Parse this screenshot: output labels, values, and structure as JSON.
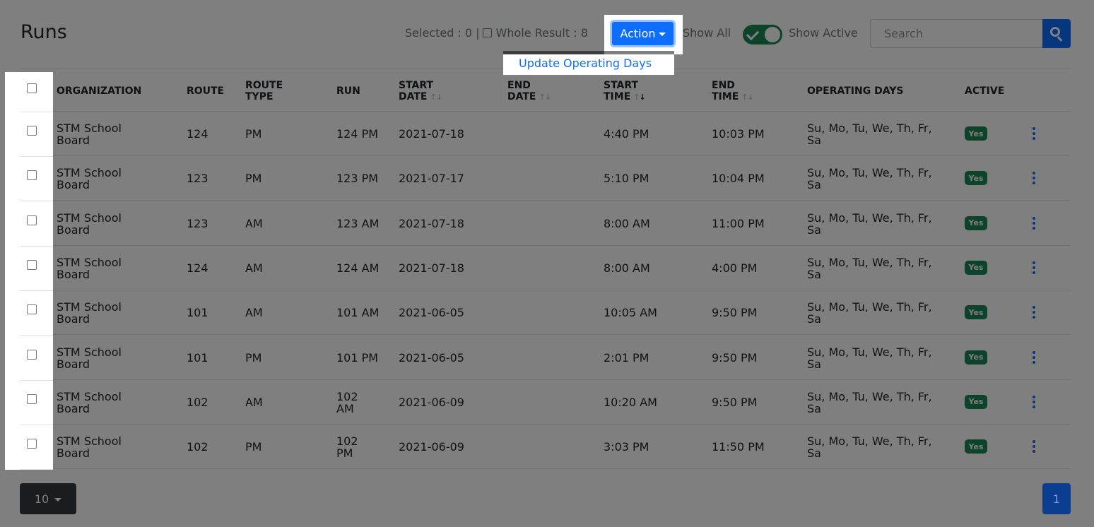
{
  "header": {
    "title": "Runs",
    "selected_label": "Selected : 0 |",
    "whole_result_label": "Whole Result : 8",
    "action_label": "Action",
    "dropdown_item": "Update Operating Days",
    "show_all_label": "Show All",
    "show_active_label": "Show Active",
    "toggle_on": true,
    "search_placeholder": "Search"
  },
  "table": {
    "columns": {
      "organization": "ORGANIZATION",
      "route": "ROUTE",
      "route_type_1": "ROUTE",
      "route_type_2": "TYPE",
      "run": "RUN",
      "start_date_1": "START",
      "start_date_2": "DATE",
      "end_date_1": "END",
      "end_date_2": "DATE",
      "start_time_1": "START",
      "start_time_2": "TIME",
      "end_time_1": "END",
      "end_time_2": "TIME",
      "operating_days": "OPERATING DAYS",
      "active": "ACTIVE"
    },
    "rows": [
      {
        "org1": "STM School",
        "org2": "Board",
        "route": "124",
        "route_type": "PM",
        "run1": "124 PM",
        "run2": "",
        "start_date": "2021-07-18",
        "end_date": "",
        "start_time": "4:40 PM",
        "end_time": "10:03 PM",
        "days1": "Su, Mo, Tu, We, Th, Fr,",
        "days2": "Sa",
        "active": "Yes"
      },
      {
        "org1": "STM School",
        "org2": "Board",
        "route": "123",
        "route_type": "PM",
        "run1": "123 PM",
        "run2": "",
        "start_date": "2021-07-17",
        "end_date": "",
        "start_time": "5:10 PM",
        "end_time": "10:04 PM",
        "days1": "Su, Mo, Tu, We, Th, Fr,",
        "days2": "Sa",
        "active": "Yes"
      },
      {
        "org1": "STM School",
        "org2": "Board",
        "route": "123",
        "route_type": "AM",
        "run1": "123 AM",
        "run2": "",
        "start_date": "2021-07-18",
        "end_date": "",
        "start_time": "8:00 AM",
        "end_time": "11:00 PM",
        "days1": "Su, Mo, Tu, We, Th, Fr,",
        "days2": "Sa",
        "active": "Yes"
      },
      {
        "org1": "STM School",
        "org2": "Board",
        "route": "124",
        "route_type": "AM",
        "run1": "124 AM",
        "run2": "",
        "start_date": "2021-07-18",
        "end_date": "",
        "start_time": "8:00 AM",
        "end_time": "4:00 PM",
        "days1": "Su, Mo, Tu, We, Th, Fr,",
        "days2": "Sa",
        "active": "Yes"
      },
      {
        "org1": "STM School",
        "org2": "Board",
        "route": "101",
        "route_type": "AM",
        "run1": "101 AM",
        "run2": "",
        "start_date": "2021-06-05",
        "end_date": "",
        "start_time": "10:05 AM",
        "end_time": "9:50 PM",
        "days1": "Su, Mo, Tu, We, Th, Fr,",
        "days2": "Sa",
        "active": "Yes"
      },
      {
        "org1": "STM School",
        "org2": "Board",
        "route": "101",
        "route_type": "PM",
        "run1": "101 PM",
        "run2": "",
        "start_date": "2021-06-05",
        "end_date": "",
        "start_time": "2:01 PM",
        "end_time": "9:50 PM",
        "days1": "Su, Mo, Tu, We, Th, Fr,",
        "days2": "Sa",
        "active": "Yes"
      },
      {
        "org1": "STM School",
        "org2": "Board",
        "route": "102",
        "route_type": "AM",
        "run1": "102",
        "run2": "AM",
        "start_date": "2021-06-09",
        "end_date": "",
        "start_time": "10:20 AM",
        "end_time": "9:50 PM",
        "days1": "Su, Mo, Tu, We, Th, Fr,",
        "days2": "Sa",
        "active": "Yes"
      },
      {
        "org1": "STM School",
        "org2": "Board",
        "route": "102",
        "route_type": "PM",
        "run1": "102",
        "run2": "PM",
        "start_date": "2021-06-09",
        "end_date": "",
        "start_time": "3:03 PM",
        "end_time": "11:50 PM",
        "days1": "Su, Mo, Tu, We, Th, Fr,",
        "days2": "Sa",
        "active": "Yes"
      }
    ]
  },
  "footer": {
    "page_size": "10",
    "current_page": "1"
  },
  "colors": {
    "primary": "#0d6efd",
    "success": "#198754",
    "dark": "#343a40",
    "overlay": "rgba(0,0,0,0.5)"
  }
}
